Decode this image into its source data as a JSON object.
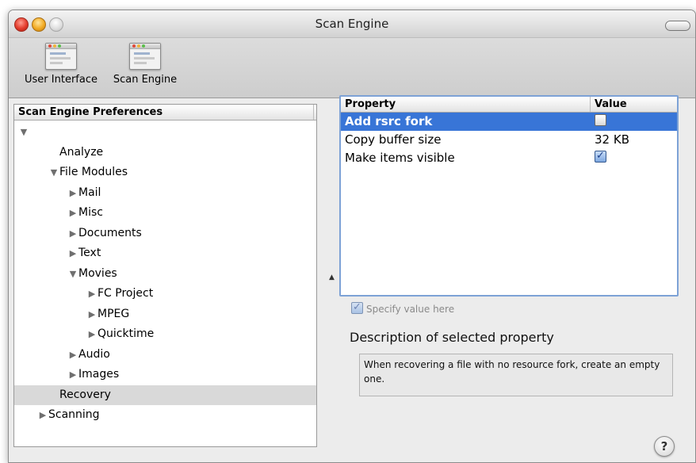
{
  "window": {
    "title": "Scan Engine"
  },
  "toolbar": {
    "items": [
      {
        "label": "User Interface",
        "icon": "preferences-window-icon"
      },
      {
        "label": "Scan Engine",
        "icon": "preferences-window-icon"
      }
    ]
  },
  "tree": {
    "header": "Scan Engine Preferences",
    "rows": [
      {
        "label": "",
        "triangle": "▼",
        "indent": 0,
        "selected": false
      },
      {
        "label": "Analyze",
        "triangle": "",
        "indent": 1,
        "selected": false
      },
      {
        "label": "File Modules",
        "triangle": "▼",
        "indent": 1,
        "selected": false
      },
      {
        "label": "Mail",
        "triangle": "▶",
        "indent": 2,
        "selected": false
      },
      {
        "label": "Misc",
        "triangle": "▶",
        "indent": 2,
        "selected": false
      },
      {
        "label": "Documents",
        "triangle": "▶",
        "indent": 2,
        "selected": false
      },
      {
        "label": "Text",
        "triangle": "▶",
        "indent": 2,
        "selected": false
      },
      {
        "label": "Movies",
        "triangle": "▼",
        "indent": 2,
        "selected": false
      },
      {
        "label": "FC Project",
        "triangle": "▶",
        "indent": 3,
        "selected": false
      },
      {
        "label": "MPEG",
        "triangle": "▶",
        "indent": 3,
        "selected": false
      },
      {
        "label": "Quicktime",
        "triangle": "▶",
        "indent": 3,
        "selected": false
      },
      {
        "label": "Audio",
        "triangle": "▶",
        "indent": 2,
        "selected": false
      },
      {
        "label": "Images",
        "triangle": "▶",
        "indent": 2,
        "selected": false
      },
      {
        "label": "Recovery",
        "triangle": "",
        "indent": 1,
        "selected": true
      },
      {
        "label": "Scanning",
        "triangle": "▶",
        "indent": 0,
        "selected": false
      }
    ]
  },
  "properties": {
    "columns": {
      "property": "Property",
      "value": "Value"
    },
    "rows": [
      {
        "name": "Add rsrc fork",
        "type": "checkbox",
        "checked": false,
        "value": "",
        "selected": true
      },
      {
        "name": "Copy buffer size",
        "type": "text",
        "checked": false,
        "value": "32 KB",
        "selected": false
      },
      {
        "name": "Make items visible",
        "type": "checkbox",
        "checked": true,
        "value": "",
        "selected": false
      }
    ]
  },
  "specify": {
    "label": "Specify value here",
    "checked": true
  },
  "description": {
    "title": "Description of selected property",
    "text": "When recovering a file with no resource fork, create an empty one."
  },
  "help": {
    "label": "?"
  },
  "colors": {
    "selection": "#3875d7",
    "tree_selection": "#d9d9d9",
    "focus_ring": "#7da2d6"
  }
}
